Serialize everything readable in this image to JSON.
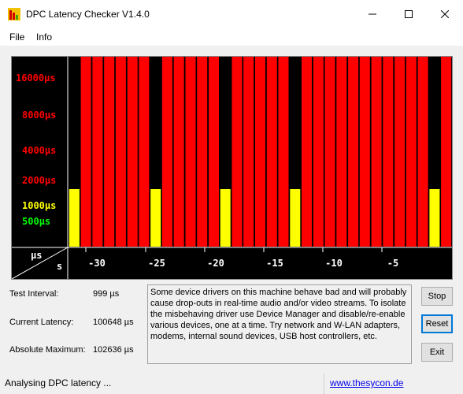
{
  "window": {
    "title": "DPC Latency Checker V1.4.0"
  },
  "menu": {
    "items": [
      "File",
      "Info"
    ]
  },
  "graph": {
    "y_labels": [
      {
        "text": "16000µs",
        "color": "#ff0000"
      },
      {
        "text": "8000µs",
        "color": "#ff0000"
      },
      {
        "text": "4000µs",
        "color": "#ff0000"
      },
      {
        "text": "2000µs",
        "color": "#ff0000"
      },
      {
        "text": "1000µs",
        "color": "#ffff00"
      },
      {
        "text": "500µs",
        "color": "#00ff00"
      }
    ],
    "unit_top": "µs",
    "unit_bottom": "s",
    "x_ticks": [
      "-30",
      "-25",
      "-20",
      "-15",
      "-10",
      "-5"
    ],
    "colors": {
      "red": "#ff0000",
      "yellow": "#ffff00",
      "black": "#000000"
    }
  },
  "chart_data": {
    "type": "bar",
    "xlabel": "s",
    "ylabel": "µs",
    "x_ticks": [
      -30,
      -25,
      -20,
      -15,
      -10,
      -5
    ],
    "y_scale": "log",
    "y_ticks": [
      500,
      1000,
      2000,
      4000,
      8000,
      16000
    ],
    "bar_pattern": [
      "yellow",
      "red",
      "red",
      "red",
      "red",
      "red",
      "red",
      "yellow",
      "red",
      "red",
      "red",
      "red",
      "red",
      "yellow",
      "red",
      "red",
      "red",
      "red",
      "red",
      "yellow",
      "red",
      "red",
      "red",
      "red",
      "red",
      "red",
      "red",
      "red",
      "red",
      "red",
      "red",
      "yellow",
      "red"
    ],
    "yellow_value_us": 1000,
    "red_value_us": 16000
  },
  "stats": {
    "test_interval_label": "Test Interval:",
    "test_interval_value": "999 µs",
    "current_latency_label": "Current Latency:",
    "current_latency_value": "100648 µs",
    "absolute_maximum_label": "Absolute Maximum:",
    "absolute_maximum_value": "102636 µs"
  },
  "info_text": "Some device drivers on this machine behave bad and will probably cause drop-outs in real-time audio and/or video streams. To isolate the misbehaving driver use Device Manager and disable/re-enable various devices, one at a time. Try network and W-LAN adapters, modems, internal sound devices, USB host controllers, etc.",
  "buttons": {
    "stop": "Stop",
    "reset": "Reset",
    "exit": "Exit"
  },
  "status": {
    "text": "Analysing DPC latency ...",
    "link": "www.thesycon.de"
  }
}
